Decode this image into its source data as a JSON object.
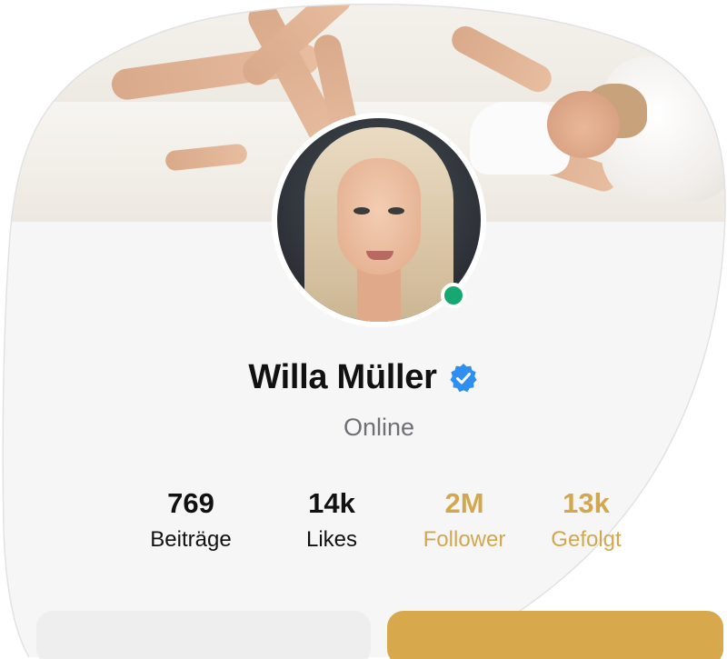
{
  "profile": {
    "name": "Willa Müller",
    "status": "Online",
    "verified": true
  },
  "stats": [
    {
      "value": "769",
      "label": "Beiträge"
    },
    {
      "value": "14k",
      "label": "Likes"
    },
    {
      "value": "2M",
      "label": "Follower"
    },
    {
      "value": "13k",
      "label": "Gefolgt"
    }
  ],
  "colors": {
    "accent": "#d3a74f",
    "online": "#16a870",
    "verified": "#2f8ff0",
    "text": "#111111",
    "muted": "#6f6f74"
  },
  "icons": {
    "verified": "verified-badge-icon",
    "online": "online-status-dot"
  }
}
